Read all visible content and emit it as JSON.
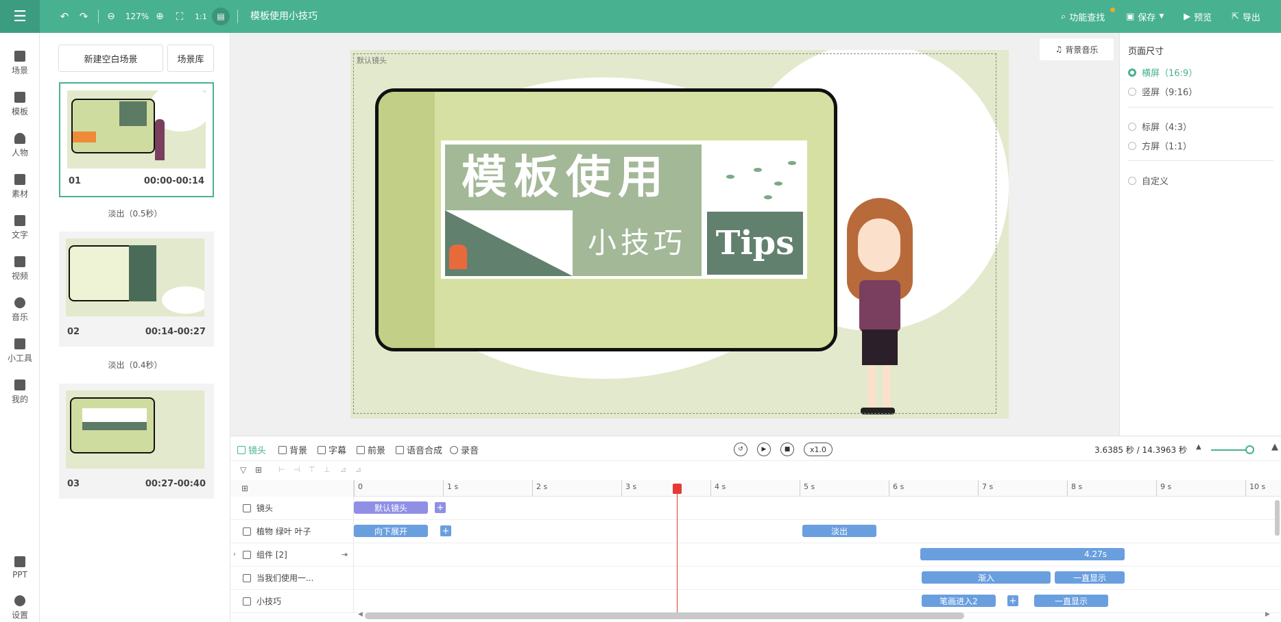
{
  "topbar": {
    "title": "模板使用小技巧",
    "zoom": "127%",
    "feature_search": "功能查找",
    "save": "保存",
    "preview": "预览",
    "export": "导出",
    "accent": "#47b190"
  },
  "rail": {
    "items": [
      "场景",
      "模板",
      "人物",
      "素材",
      "文字",
      "视频",
      "音乐",
      "小工具",
      "我的"
    ],
    "bottom": [
      "PPT",
      "设置"
    ]
  },
  "scenes": {
    "new_blank": "新建空白场景",
    "library": "场景库",
    "cards": [
      {
        "num": "01",
        "time": "00:00-00:14"
      },
      {
        "num": "02",
        "time": "00:14-00:27"
      },
      {
        "num": "03",
        "time": "00:27-00:40"
      }
    ],
    "transitions": [
      "淡出（0.5秒）",
      "淡出（0.4秒）"
    ]
  },
  "canvas": {
    "default_camera": "默认镜头",
    "bg_music": "背景音乐",
    "headline": "模板使用",
    "subline": "小技巧",
    "tips": "Tips"
  },
  "page_size": {
    "title": "页面尺寸",
    "options": [
      {
        "label": "横屏（16:9）",
        "selected": true
      },
      {
        "label": "竖屏（9:16）",
        "selected": false
      },
      {
        "label": "标屏（4:3）",
        "selected": false
      },
      {
        "label": "方屏（1:1）",
        "selected": false
      },
      {
        "label": "自定义",
        "selected": false
      }
    ]
  },
  "timeline": {
    "tabs": [
      "镜头",
      "背景",
      "字幕",
      "前景",
      "语音合成",
      "录音"
    ],
    "speed": "x1.0",
    "time_info": "3.6385 秒 / 14.3963 秒",
    "ticks": [
      "0",
      "1 s",
      "2 s",
      "3 s",
      "4 s",
      "5 s",
      "6 s",
      "7 s",
      "8 s",
      "9 s",
      "10 s"
    ],
    "tracks": [
      {
        "name": "镜头",
        "clips": [
          "默认镜头"
        ]
      },
      {
        "name": "植物 绿叶 叶子",
        "clips": [
          "向下展开",
          "淡出"
        ]
      },
      {
        "name": "组件 [2]",
        "clips": [
          "4.27s"
        ]
      },
      {
        "name": "当我们使用一...",
        "clips": [
          "渐入",
          "一直显示"
        ]
      },
      {
        "name": "小技巧",
        "clips": [
          "笔画进入2",
          "一直显示"
        ]
      }
    ],
    "playhead_seconds": 3.6385
  }
}
